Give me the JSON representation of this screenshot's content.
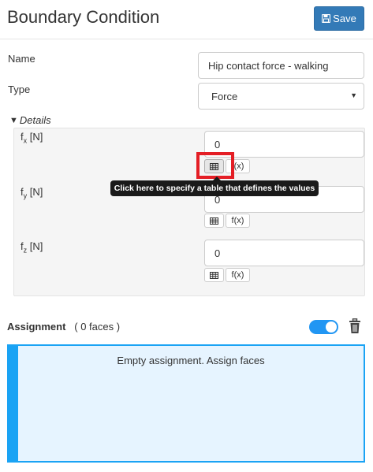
{
  "header": {
    "title": "Boundary Condition",
    "save_label": "Save"
  },
  "form": {
    "name_label": "Name",
    "name_value": "Hip contact force - walking",
    "type_label": "Type",
    "type_value": "Force"
  },
  "details": {
    "header": "Details",
    "components": [
      {
        "symbol": "f",
        "sub": "x",
        "unit": "[N]",
        "value": "0",
        "fx_label": "f(x)"
      },
      {
        "symbol": "f",
        "sub": "y",
        "unit": "[N]",
        "value": "0",
        "fx_label": "f(x)"
      },
      {
        "symbol": "f",
        "sub": "z",
        "unit": "[N]",
        "value": "0",
        "fx_label": "f(x)"
      }
    ]
  },
  "tooltip": {
    "text": "Click here to specify a table that defines the values"
  },
  "assignment": {
    "label": "Assignment",
    "count_text": "( 0 faces )",
    "toggle_on": true,
    "empty_text": "Empty assignment. Assign faces"
  },
  "colors": {
    "primary": "#337ab7",
    "accent": "#2196f3",
    "assignment_border": "#1aa3f4",
    "assignment_bg": "#e6f4ff",
    "highlight": "#e41e25"
  },
  "icons": {
    "save": "floppy-disk-icon",
    "table": "table-icon",
    "trash": "trash-icon",
    "dropdown": "caret-down-icon"
  }
}
